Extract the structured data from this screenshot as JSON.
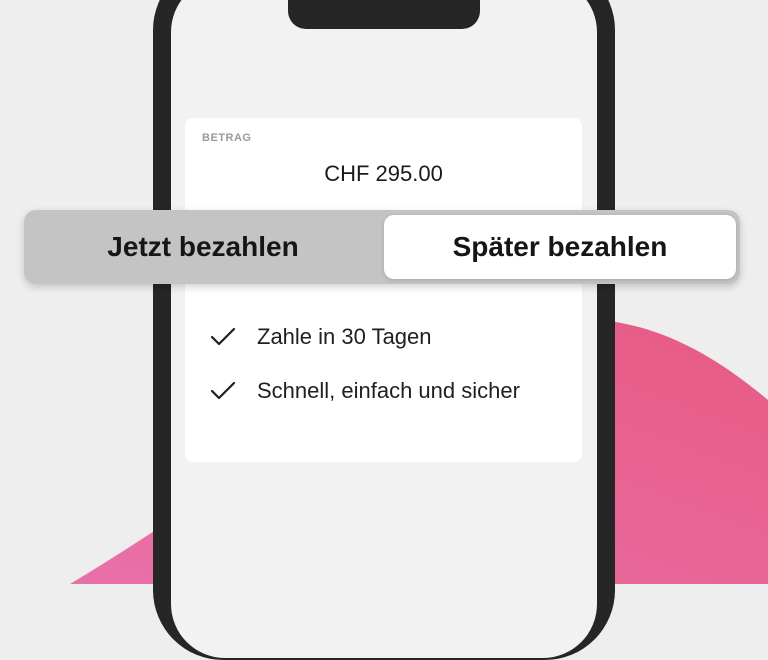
{
  "colors": {
    "background": "#eeeeee",
    "accent_pink": "#e85a86",
    "phone_frame": "#262626",
    "toggle_inactive": "#c4c4c4",
    "toggle_active": "#ffffff"
  },
  "payment": {
    "amount_label": "BETRAG",
    "amount_value": "CHF 295.00"
  },
  "toggle": {
    "options": [
      {
        "label": "Jetzt bezahlen",
        "selected": false
      },
      {
        "label": "Später bezahlen",
        "selected": true
      }
    ]
  },
  "features": [
    {
      "icon": "check-icon",
      "text": "Zahle in 30 Tagen"
    },
    {
      "icon": "check-icon",
      "text": "Schnell, einfach und sicher"
    }
  ]
}
